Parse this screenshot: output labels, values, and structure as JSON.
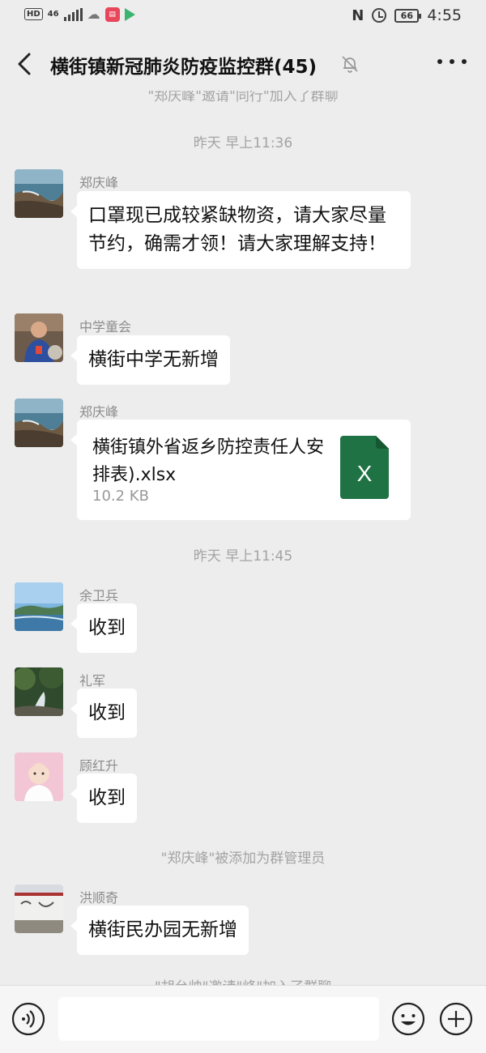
{
  "status_bar": {
    "hd_tag": "HD",
    "network": "46",
    "battery": "66",
    "time": "4:55"
  },
  "header": {
    "title": "横街镇新冠肺炎防疫监控群(45)"
  },
  "chat": {
    "system_top": "\"郑庆峰\"邀请\"同行\"加入了群聊",
    "timestamp_1": "昨天 早上11:36",
    "timestamp_2": "昨天 早上11:45",
    "system_admin": "\"郑庆峰\"被添加为群管理员",
    "system_bottom": "\"胡台帅\"邀请\"峰\"加入了群聊",
    "messages": [
      {
        "sender": "郑庆峰",
        "text": "口罩现已成较紧缺物资，请大家尽量节约，确需才领！请大家理解支持！"
      },
      {
        "sender": "中学童会",
        "text": "横街中学无新增"
      },
      {
        "sender": "郑庆峰",
        "file_name": "横街镇外省返乡防控责任人安排表).xlsx",
        "file_size": "10.2 KB",
        "file_icon_letter": "X"
      },
      {
        "sender": "余卫兵",
        "text": "收到"
      },
      {
        "sender": "礼军",
        "text": "收到"
      },
      {
        "sender": "顾红升",
        "text": "收到"
      },
      {
        "sender": "洪顺奇",
        "text": "横街民办园无新增"
      }
    ]
  },
  "input_bar": {
    "placeholder": ""
  },
  "colors": {
    "background": "#ededed",
    "bubble": "#ffffff",
    "excel_green": "#1f7244",
    "meta_text": "#a3a3a3"
  },
  "icons": [
    "back-arrow-icon",
    "mute-bell-icon",
    "more-dots-icon",
    "voice-icon",
    "emoji-icon",
    "plus-icon",
    "excel-file-icon"
  ]
}
